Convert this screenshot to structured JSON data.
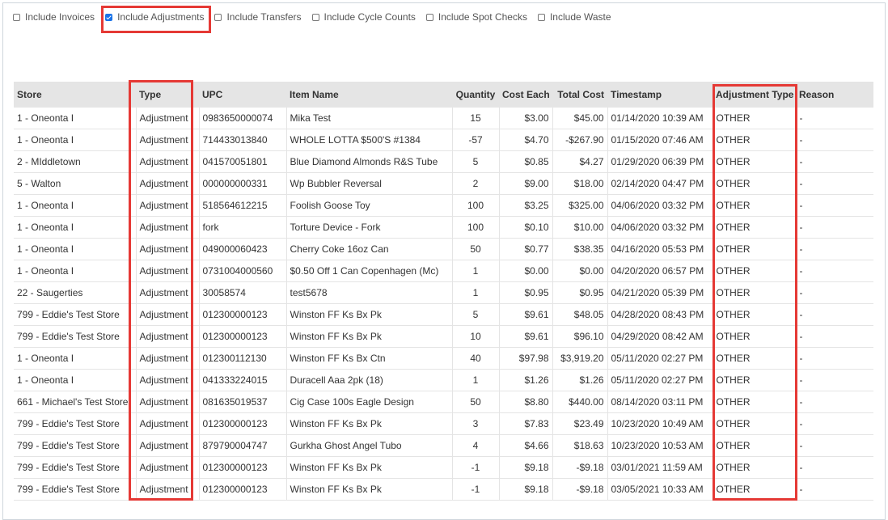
{
  "filters": [
    {
      "label": "Include Invoices",
      "checked": false
    },
    {
      "label": "Include Adjustments",
      "checked": true
    },
    {
      "label": "Include Transfers",
      "checked": false
    },
    {
      "label": "Include Cycle Counts",
      "checked": false
    },
    {
      "label": "Include Spot Checks",
      "checked": false
    },
    {
      "label": "Include Waste",
      "checked": false
    }
  ],
  "table": {
    "columns": [
      "Store",
      "Type",
      "UPC",
      "Item Name",
      "Quantity",
      "Cost Each",
      "Total Cost",
      "Timestamp",
      "Adjustment Type",
      "Reason"
    ],
    "rows": [
      [
        "1 - Oneonta I",
        "Adjustment",
        "0983650000074",
        "Mika Test",
        "15",
        "$3.00",
        "$45.00",
        "01/14/2020 10:39 AM",
        "OTHER",
        "-"
      ],
      [
        "1 - Oneonta I",
        "Adjustment",
        "714433013840",
        "WHOLE LOTTA $500'S #1384",
        "-57",
        "$4.70",
        "-$267.90",
        "01/15/2020 07:46 AM",
        "OTHER",
        "-"
      ],
      [
        "2 - MIddletown",
        "Adjustment",
        "041570051801",
        "Blue Diamond Almonds R&S Tube",
        "5",
        "$0.85",
        "$4.27",
        "01/29/2020 06:39 PM",
        "OTHER",
        "-"
      ],
      [
        "5 - Walton",
        "Adjustment",
        "000000000331",
        "Wp Bubbler Reversal",
        "2",
        "$9.00",
        "$18.00",
        "02/14/2020 04:47 PM",
        "OTHER",
        "-"
      ],
      [
        "1 - Oneonta I",
        "Adjustment",
        "518564612215",
        "Foolish Goose Toy",
        "100",
        "$3.25",
        "$325.00",
        "04/06/2020 03:32 PM",
        "OTHER",
        "-"
      ],
      [
        "1 - Oneonta I",
        "Adjustment",
        "fork",
        "Torture Device - Fork",
        "100",
        "$0.10",
        "$10.00",
        "04/06/2020 03:32 PM",
        "OTHER",
        "-"
      ],
      [
        "1 - Oneonta I",
        "Adjustment",
        "049000060423",
        "Cherry Coke 16oz Can",
        "50",
        "$0.77",
        "$38.35",
        "04/16/2020 05:53 PM",
        "OTHER",
        "-"
      ],
      [
        "1 - Oneonta I",
        "Adjustment",
        "0731004000560",
        "$0.50 Off 1 Can Copenhagen (Mc)",
        "1",
        "$0.00",
        "$0.00",
        "04/20/2020 06:57 PM",
        "OTHER",
        "-"
      ],
      [
        "22 - Saugerties",
        "Adjustment",
        "30058574",
        "test5678",
        "1",
        "$0.95",
        "$0.95",
        "04/21/2020 05:39 PM",
        "OTHER",
        "-"
      ],
      [
        "799 - Eddie's Test Store",
        "Adjustment",
        "012300000123",
        "Winston FF Ks Bx Pk",
        "5",
        "$9.61",
        "$48.05",
        "04/28/2020 08:43 PM",
        "OTHER",
        "-"
      ],
      [
        "799 - Eddie's Test Store",
        "Adjustment",
        "012300000123",
        "Winston FF Ks Bx Pk",
        "10",
        "$9.61",
        "$96.10",
        "04/29/2020 08:42 AM",
        "OTHER",
        "-"
      ],
      [
        "1 - Oneonta I",
        "Adjustment",
        "012300112130",
        "Winston FF Ks Bx Ctn",
        "40",
        "$97.98",
        "$3,919.20",
        "05/11/2020 02:27 PM",
        "OTHER",
        "-"
      ],
      [
        "1 - Oneonta I",
        "Adjustment",
        "041333224015",
        "Duracell Aaa 2pk (18)",
        "1",
        "$1.26",
        "$1.26",
        "05/11/2020 02:27 PM",
        "OTHER",
        "-"
      ],
      [
        "661 - Michael's Test Store",
        "Adjustment",
        "081635019537",
        "Cig Case 100s Eagle Design",
        "50",
        "$8.80",
        "$440.00",
        "08/14/2020 03:11 PM",
        "OTHER",
        "-"
      ],
      [
        "799 - Eddie's Test Store",
        "Adjustment",
        "012300000123",
        "Winston FF Ks Bx Pk",
        "3",
        "$7.83",
        "$23.49",
        "10/23/2020 10:49 AM",
        "OTHER",
        "-"
      ],
      [
        "799 - Eddie's Test Store",
        "Adjustment",
        "879790004747",
        "Gurkha Ghost Angel Tubo",
        "4",
        "$4.66",
        "$18.63",
        "10/23/2020 10:53 AM",
        "OTHER",
        "-"
      ],
      [
        "799 - Eddie's Test Store",
        "Adjustment",
        "012300000123",
        "Winston FF Ks Bx Pk",
        "-1",
        "$9.18",
        "-$9.18",
        "03/01/2021 11:59 AM",
        "OTHER",
        "-"
      ],
      [
        "799 - Eddie's Test Store",
        "Adjustment",
        "012300000123",
        "Winston FF Ks Bx Pk",
        "-1",
        "$9.18",
        "-$9.18",
        "03/05/2021 10:33 AM",
        "OTHER",
        "-"
      ]
    ]
  },
  "colors": {
    "highlight": "#e53935",
    "checkbox_accent": "#1a73e8",
    "header_bg": "#e5e5e5"
  }
}
